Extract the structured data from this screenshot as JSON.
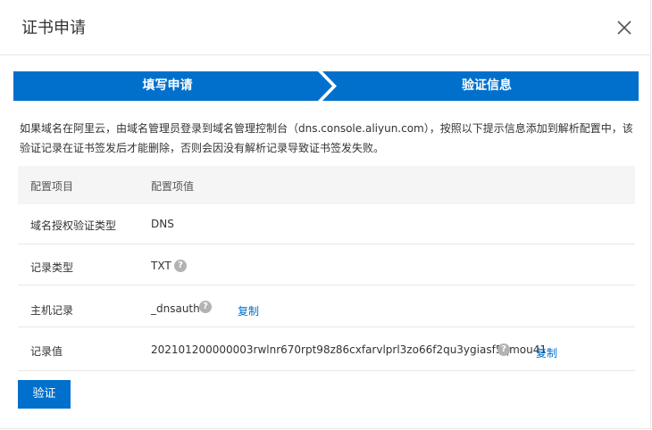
{
  "dialog": {
    "title": "证书申请"
  },
  "steps": [
    {
      "label": "填写申请"
    },
    {
      "label": "验证信息"
    }
  ],
  "intro_text": "如果域名在阿里云，由域名管理员登录到域名管理控制台（dns.console.aliyun.com），按照以下提示信息添加到解析配置中，该验证记录在证书签发后才能删除，否则会因没有解析记录导致证书签发失败。",
  "table": {
    "headers": [
      "配置项目",
      "配置项值"
    ],
    "rows": [
      {
        "label": "域名授权验证类型",
        "value": "DNS"
      },
      {
        "label": "记录类型",
        "value": "TXT"
      },
      {
        "label": "主机记录",
        "value": "_dnsauth",
        "copy": "复制"
      },
      {
        "label": "记录值",
        "value": "202101200000003rwlnr670rpt98z86cxfarvlprl3zo66f2qu3ygiasf5qmou41",
        "copy": "复制"
      }
    ]
  },
  "help_glyph": "?",
  "verify_button": "验证",
  "colors": {
    "accent": "#0070cc",
    "help_icon": "#b3b3b3",
    "table_header_bg": "#f5f5f6"
  }
}
